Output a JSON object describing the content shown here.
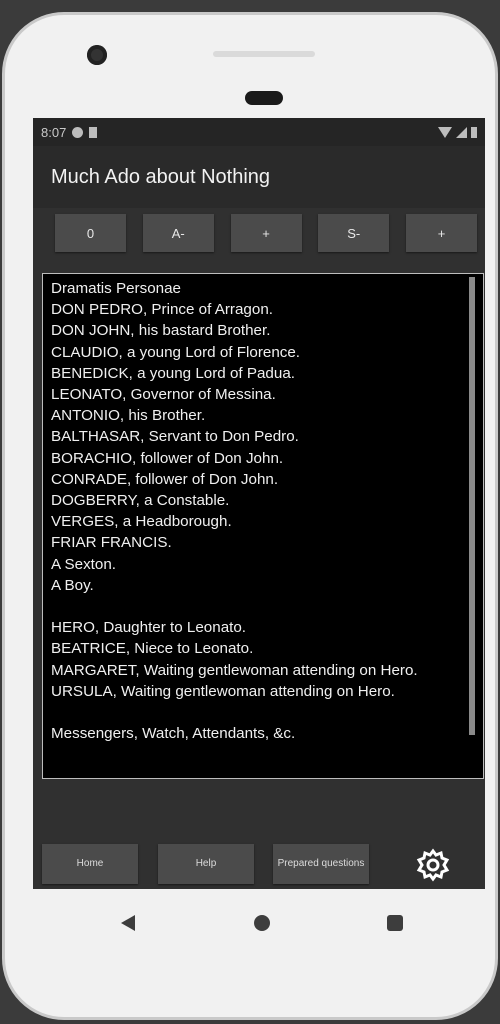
{
  "status_bar": {
    "time": "8:07"
  },
  "app_bar": {
    "title": "Much Ado about Nothing"
  },
  "toolbar": {
    "buttons": [
      "0",
      "A-",
      "+",
      "S-",
      "+"
    ]
  },
  "text_panel": {
    "content": "Dramatis Personae\nDON PEDRO, Prince of Arragon.\nDON JOHN, his bastard Brother.\nCLAUDIO, a young Lord of Florence.\nBENEDICK, a young Lord of Padua.\nLEONATO, Governor of Messina.\nANTONIO, his Brother.\nBALTHASAR, Servant to Don Pedro.\nBORACHIO, follower of Don John.\nCONRADE, follower of Don John.\nDOGBERRY, a Constable.\nVERGES, a Headborough.\nFRIAR FRANCIS.\nA Sexton.\nA Boy.\n\nHERO, Daughter to Leonato.\nBEATRICE, Niece to Leonato.\nMARGARET, Waiting gentlewoman attending on Hero.\nURSULA, Waiting gentlewoman attending on Hero.\n\nMessengers, Watch, Attendants, &c."
  },
  "bottom_buttons": {
    "home": "Home",
    "help": "Help",
    "prepared": "Prepared questions"
  },
  "icons": {
    "settings": "gear-icon",
    "back": "back-icon",
    "home": "home-nav-icon",
    "recents": "recents-icon"
  },
  "colors": {
    "screen_bg": "#303030",
    "text_bg": "#000000",
    "button_bg": "#4b4b4b"
  }
}
